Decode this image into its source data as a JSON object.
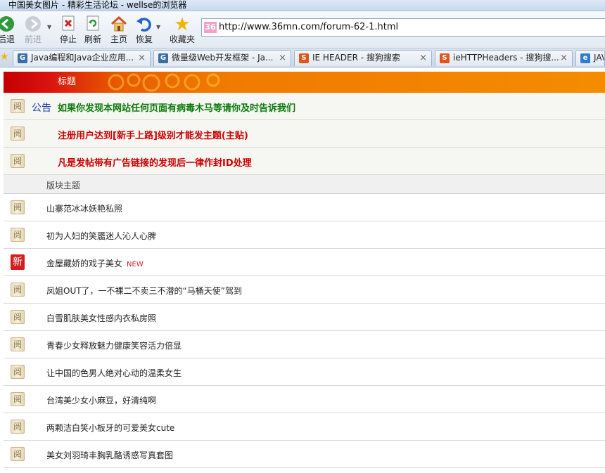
{
  "window": {
    "title": "中国美女图片 - 精彩生活论坛 - wellse的浏览器"
  },
  "toolbar": {
    "back": "后退",
    "forward": "前进",
    "stop": "停止",
    "refresh": "刷新",
    "home": "主页",
    "restore": "恢复",
    "favorites": "收藏夹",
    "address_icon": "36",
    "address": "http://www.36mn.com/forum-62-1.html"
  },
  "tabs": [
    {
      "label": "Java编程和Java企业应用...",
      "icon": "G",
      "color": "#3a6ea5"
    },
    {
      "label": "微量级Web开发框架 - Ja...",
      "icon": "G",
      "color": "#3a6ea5"
    },
    {
      "label": "IE HEADER - 搜狗搜索",
      "icon": "S",
      "color": "#e1541a"
    },
    {
      "label": "ieHTTPHeaders - 搜狗搜...",
      "icon": "S",
      "color": "#e1541a"
    },
    {
      "label": "JAV",
      "icon": "e",
      "color": "#2f7bd0"
    }
  ],
  "tab_close": "×",
  "forum": {
    "header_title": "标题",
    "announcement_label": "公告",
    "notices": [
      {
        "text": "如果你发现本网站任何页面有病毒木马等请你及时告诉我们",
        "color": "#0a7a0a"
      },
      {
        "text": "注册用户达到[新手上路]级别才能发主题(主贴)",
        "color": "#cc0000"
      },
      {
        "text": "凡是发帖带有广告链接的发现后一律作封ID处理",
        "color": "#cc0000"
      }
    ],
    "section_title": "版块主题",
    "read_icon": "阅",
    "new_icon": "新",
    "new_tag": "NEW",
    "threads": [
      {
        "title": "山寨范冰冰妖艳私照",
        "is_new": false
      },
      {
        "title": "初为人妇的笑靥迷人沁人心脾",
        "is_new": false
      },
      {
        "title": "金屋藏娇的戏子美女",
        "is_new": true
      },
      {
        "title": "凤姐OUT了，一不裸二不卖三不潜的“马桶天使”驾到",
        "is_new": false
      },
      {
        "title": "白雪肌肤美女性感内衣私房照",
        "is_new": false
      },
      {
        "title": "青春少女释放魅力健康笑容活力倍显",
        "is_new": false
      },
      {
        "title": "让中国的色男人绝对心动的温柔女生",
        "is_new": false
      },
      {
        "title": "台湾美少女小麻豆，好清纯啊",
        "is_new": false
      },
      {
        "title": "两颗洁白笑小板牙的可爱美女cute",
        "is_new": false
      },
      {
        "title": "美女刘羽琦丰胸乳酪诱惑写真套图",
        "is_new": false
      }
    ]
  }
}
